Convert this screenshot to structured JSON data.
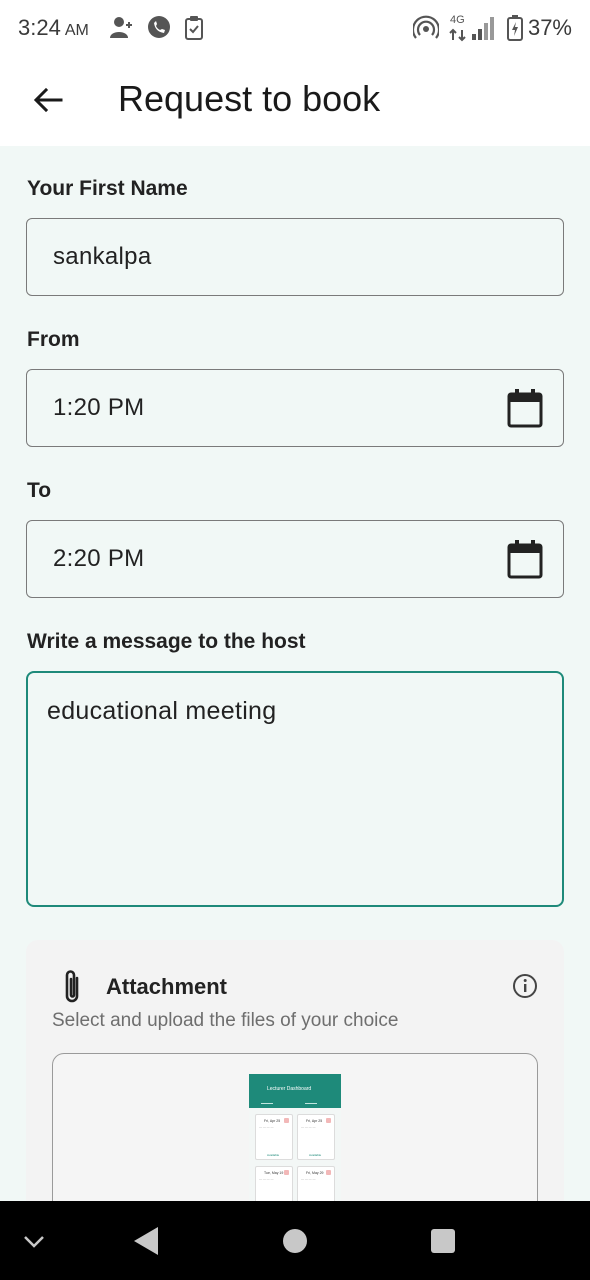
{
  "status_bar": {
    "time": "3:24",
    "ampm": "AM",
    "network": "4G",
    "battery": "37%",
    "icons": [
      "add-contact-icon",
      "viber-icon",
      "clipboard-icon",
      "hotspot-icon",
      "signal-icon",
      "battery-charging-icon"
    ]
  },
  "app_bar": {
    "title": "Request to book",
    "back_icon": "arrow-left-icon"
  },
  "form": {
    "first_name": {
      "label": "Your First Name",
      "value": "sankalpa"
    },
    "from": {
      "label": "From",
      "value": "1:20 PM",
      "icon": "calendar-icon"
    },
    "to": {
      "label": "To",
      "value": "2:20 PM",
      "icon": "calendar-icon"
    },
    "message": {
      "label": "Write a message to the host",
      "value": "educational meeting"
    }
  },
  "attachment": {
    "title": "Attachment",
    "subtitle": "Select and upload the files of your choice",
    "icons": [
      "paperclip-icon",
      "info-icon"
    ],
    "thumbnail": {
      "header_title": "Lecturer Dashboard",
      "cards": [
        {
          "date": "Fri, Apr 25",
          "status": "Available"
        },
        {
          "date": "Fri, Apr 25",
          "status": "Available"
        },
        {
          "date": "Tue, May 19",
          "status": ""
        },
        {
          "date": "Fri, May 29",
          "status": ""
        }
      ]
    }
  },
  "nav_bar": {
    "icons": [
      "chevron-down-icon",
      "back-triangle-icon",
      "home-circle-icon",
      "recents-square-icon"
    ]
  },
  "colors": {
    "accent": "#1e8a7a",
    "background": "#f1f8f6",
    "nav_bar": "#000000"
  }
}
